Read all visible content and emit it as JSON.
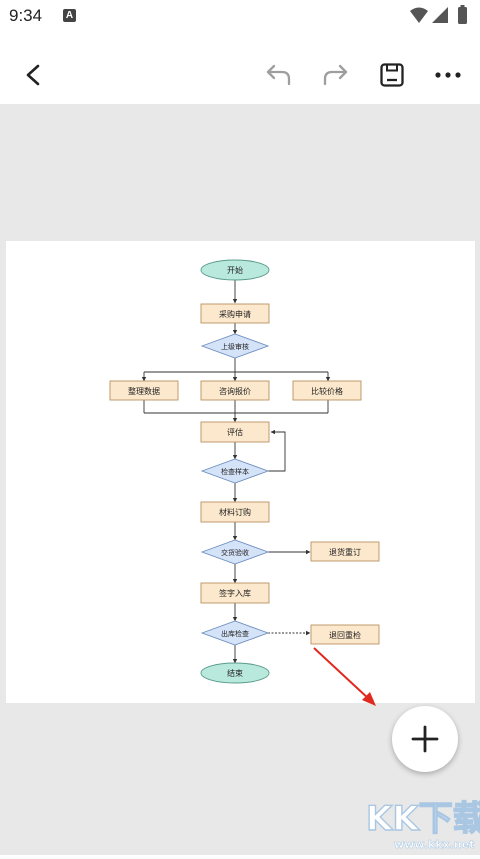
{
  "status_bar": {
    "time": "9:34",
    "notification_letter": "A"
  },
  "toolbar": {
    "back_icon": "back-arrow-icon",
    "undo_icon": "undo-icon",
    "redo_icon": "redo-icon",
    "save_icon": "save-icon",
    "more_icon": "more-vert-icon"
  },
  "flowchart": {
    "start": "开始",
    "purchase_request": "采购申请",
    "superior_review": "上级审核",
    "organize_data": "整理数据",
    "inquire_quote": "咨询报价",
    "compare_prices": "比较价格",
    "evaluate": "评估",
    "inspect_sample": "检查样本",
    "material_order": "材料订购",
    "delivery_acceptance": "交货验收",
    "return_reorder": "退货重订",
    "sign_storage": "签字入库",
    "outbound_check": "出库检查",
    "return_recheck": "退回重检",
    "end": "结束"
  },
  "fab": {
    "icon": "plus-icon"
  },
  "watermark": {
    "brand": "KK下载",
    "url": "www.kkx.net"
  }
}
